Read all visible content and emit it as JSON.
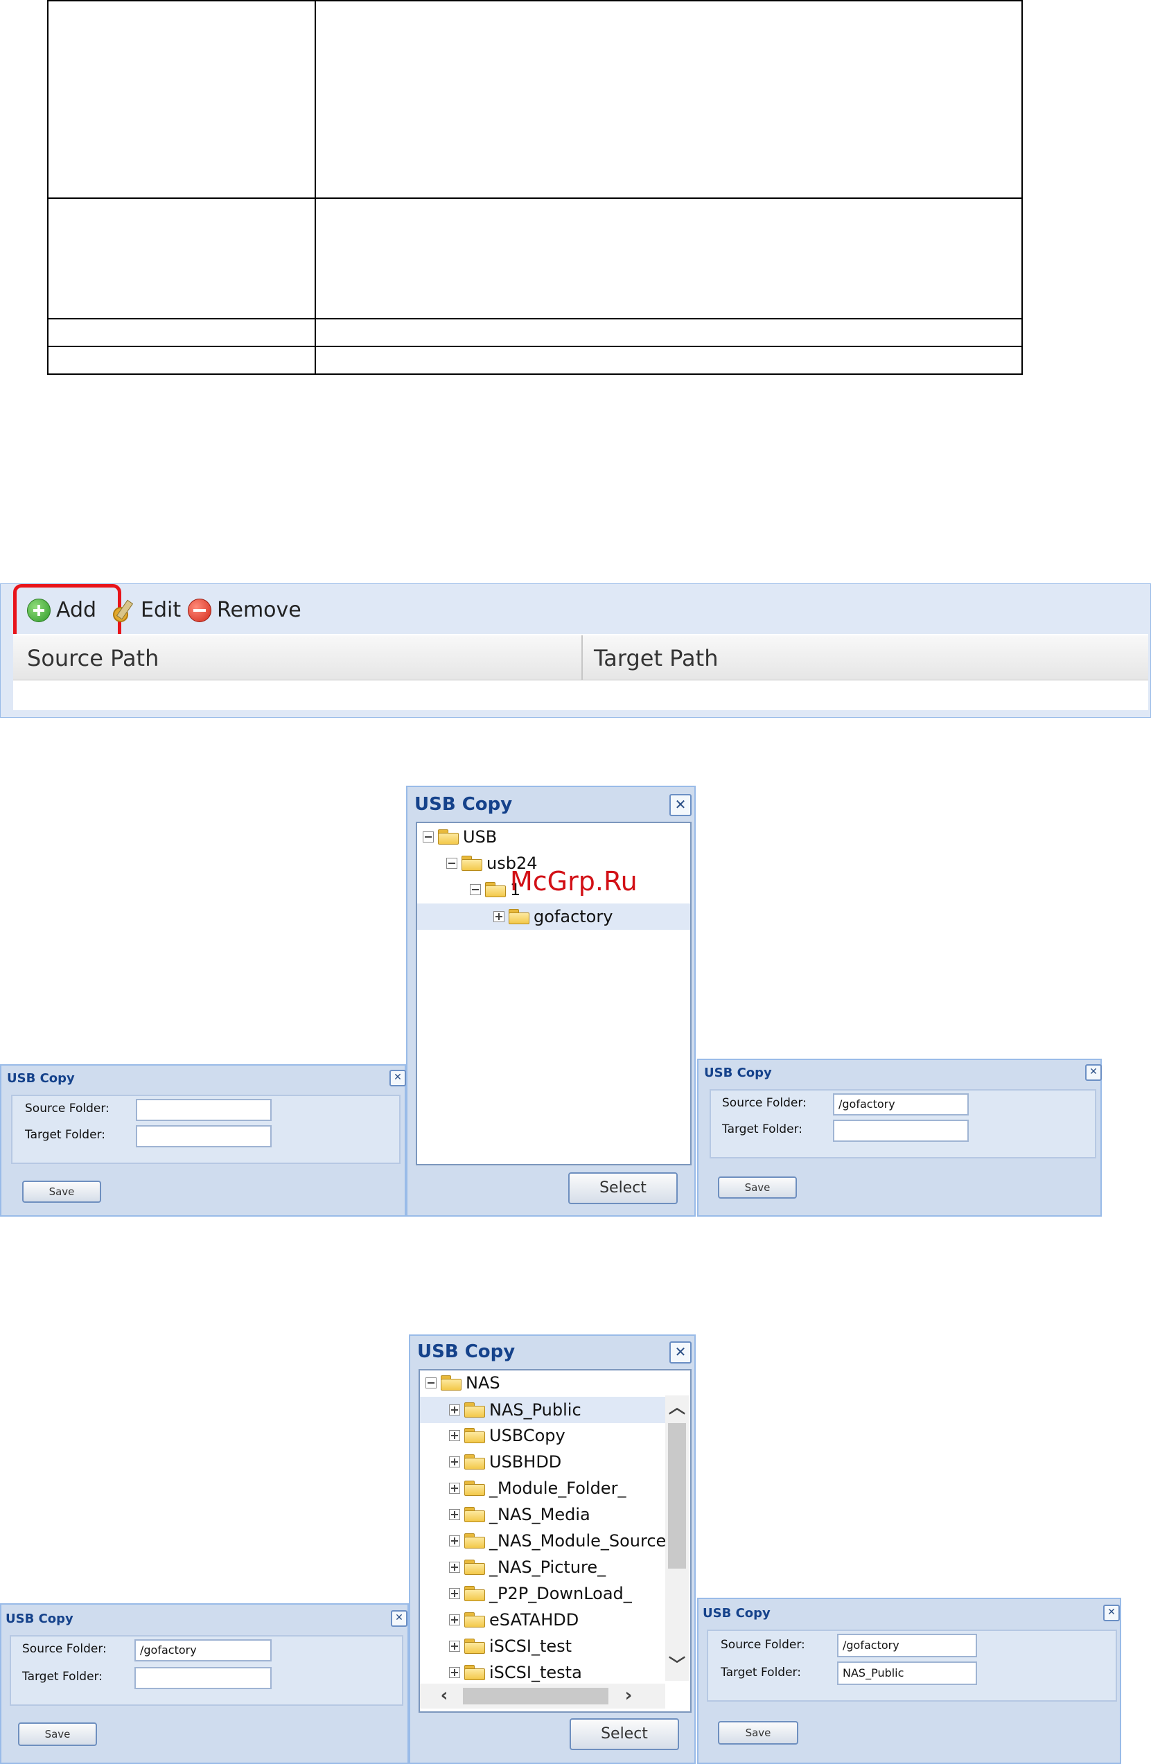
{
  "toolbar": {
    "add_label": "Add",
    "edit_label": "Edit",
    "remove_label": "Remove",
    "columns": [
      "Source Path",
      "Target Path"
    ]
  },
  "form_dialog_1": {
    "title": "USB Copy",
    "source_label": "Source Folder:",
    "target_label": "Target Folder:",
    "source_value": "",
    "target_value": "",
    "save_label": "Save"
  },
  "tree_dialog_1": {
    "title": "USB Copy",
    "nodes": [
      "USB",
      "usb24",
      "1",
      "gofactory"
    ],
    "select_label": "Select",
    "watermark": "McGrp.Ru"
  },
  "form_dialog_2": {
    "title": "USB Copy",
    "source_label": "Source Folder:",
    "target_label": "Target Folder:",
    "source_value": "/gofactory",
    "target_value": "",
    "save_label": "Save"
  },
  "form_dialog_3": {
    "title": "USB Copy",
    "source_label": "Source Folder:",
    "target_label": "Target Folder:",
    "source_value": "/gofactory",
    "target_value": "",
    "save_label": "Save"
  },
  "tree_dialog_2": {
    "title": "USB Copy",
    "root": "NAS",
    "items": [
      "NAS_Public",
      "USBCopy",
      "USBHDD",
      "_Module_Folder_",
      "_NAS_Media",
      "_NAS_Module_Source_",
      "_NAS_Picture_",
      "_P2P_DownLoad_",
      "eSATAHDD",
      "iSCSI_test",
      "iSCSI_testa"
    ],
    "select_label": "Select"
  },
  "form_dialog_4": {
    "title": "USB Copy",
    "source_label": "Source Folder:",
    "target_label": "Target Folder:",
    "source_value": "/gofactory",
    "target_value": "NAS_Public",
    "save_label": "Save"
  }
}
